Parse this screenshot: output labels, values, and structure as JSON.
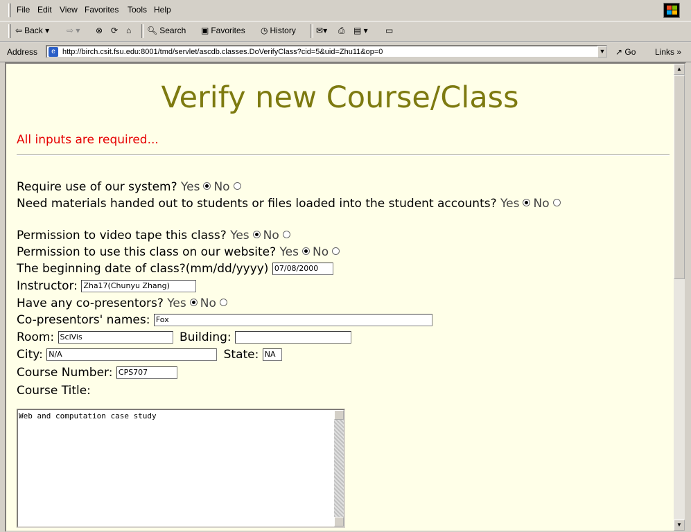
{
  "menu": [
    "File",
    "Edit",
    "View",
    "Favorites",
    "Tools",
    "Help"
  ],
  "toolbar": {
    "back": "Back",
    "search": "Search",
    "favorites": "Favorites",
    "history": "History"
  },
  "address": {
    "label": "Address",
    "url": "http://birch.csit.fsu.edu:8001/tmd/servlet/ascdb.classes.DoVerifyClass?cid=5&uid=Zhu11&op=0",
    "go": "Go",
    "links": "Links"
  },
  "page": {
    "title": "Verify new Course/Class",
    "required_note": "All inputs are required...",
    "yes": "Yes",
    "no": "No",
    "q_system": "Require use of our system?",
    "q_materials": "Need materials handed out to students or files loaded into the student accounts?",
    "q_video": "Permission to video tape this class?",
    "q_website": "Permission to use this class on our website?",
    "q_date": "The beginning date of class?(mm/dd/yyyy)",
    "date_value": "07/08/2000",
    "instructor_label": "Instructor:",
    "instructor_value": "Zha17(Chunyu Zhang)",
    "q_copresentors": "Have any co-presentors?",
    "copresentor_label": "Co-presentors' names:",
    "copresentor_value": "Fox",
    "room_label": "Room:",
    "room_value": "SciVis",
    "building_label": "Building:",
    "building_value": "",
    "city_label": "City:",
    "city_value": "N/A",
    "state_label": "State:",
    "state_value": "NA",
    "course_number_label": "Course Number:",
    "course_number_value": "CPS707",
    "course_title_label": "Course Title:",
    "course_title_value": "Web and computation case study"
  }
}
